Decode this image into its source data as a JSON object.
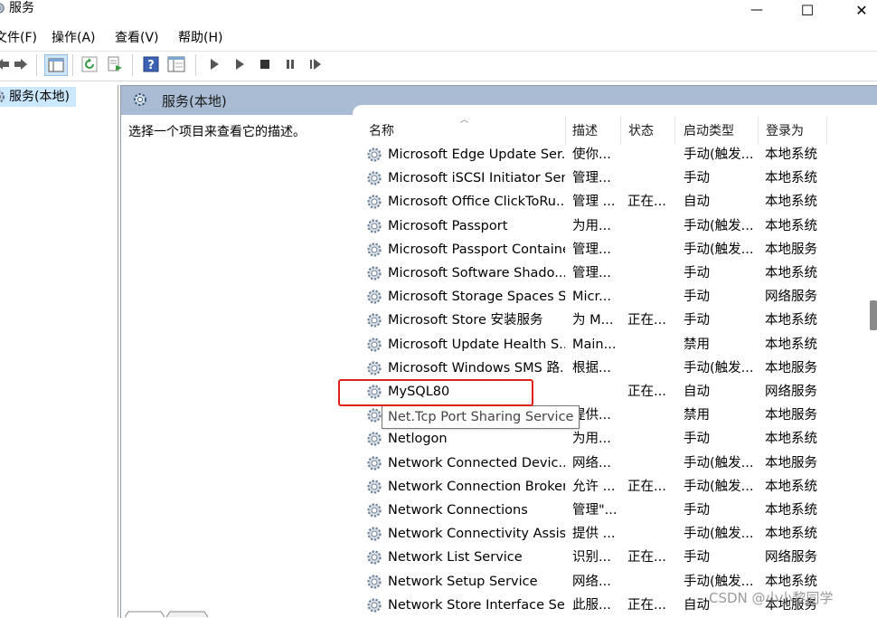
{
  "window": {
    "title": "服务",
    "controls": [
      "—",
      "☐",
      "✕"
    ]
  },
  "menu": {
    "items": [
      "文件(F)",
      "操作(A)",
      "查看(V)",
      "帮助(H)"
    ]
  },
  "tree": {
    "selected_label": "服务(本地)"
  },
  "right": {
    "header_title": "服务(本地)",
    "description": "选择一个项目来查看它的描述。"
  },
  "columns": {
    "name": "名称",
    "description": "描述",
    "status": "状态",
    "startup": "启动类型",
    "logon": "登录为"
  },
  "services": [
    {
      "name": "Microsoft Edge Update Ser...",
      "desc": "使你...",
      "status": "",
      "startup": "手动(触发...",
      "logon": "本地系统"
    },
    {
      "name": "Microsoft iSCSI Initiator Ser...",
      "desc": "管理...",
      "status": "",
      "startup": "手动",
      "logon": "本地系统"
    },
    {
      "name": "Microsoft Office ClickToRu...",
      "desc": "管理 ...",
      "status": "正在...",
      "startup": "自动",
      "logon": "本地系统"
    },
    {
      "name": "Microsoft Passport",
      "desc": "为用...",
      "status": "",
      "startup": "手动(触发...",
      "logon": "本地系统"
    },
    {
      "name": "Microsoft Passport Container",
      "desc": "管理...",
      "status": "",
      "startup": "手动(触发...",
      "logon": "本地服务"
    },
    {
      "name": "Microsoft Software Shado...",
      "desc": "管理...",
      "status": "",
      "startup": "手动",
      "logon": "本地系统"
    },
    {
      "name": "Microsoft Storage Spaces S...",
      "desc": "Micr...",
      "status": "",
      "startup": "手动",
      "logon": "网络服务"
    },
    {
      "name": "Microsoft Store 安装服务",
      "desc": "为 M...",
      "status": "正在...",
      "startup": "手动",
      "logon": "本地系统"
    },
    {
      "name": "Microsoft Update Health S...",
      "desc": "Main...",
      "status": "",
      "startup": "禁用",
      "logon": "本地系统"
    },
    {
      "name": "Microsoft Windows SMS 路...",
      "desc": "根据...",
      "status": "",
      "startup": "手动(触发...",
      "logon": "本地服务"
    },
    {
      "name": "MySQL80",
      "desc": "",
      "status": "正在...",
      "startup": "自动",
      "logon": "网络服务"
    },
    {
      "name": "Net.Tcp Port Sharing Service",
      "desc": "提供...",
      "status": "",
      "startup": "禁用",
      "logon": "本地服务"
    },
    {
      "name": "Netlogon",
      "desc": "为用...",
      "status": "",
      "startup": "手动",
      "logon": "本地系统"
    },
    {
      "name": "Network Connected Devic...",
      "desc": "网络...",
      "status": "",
      "startup": "手动(触发...",
      "logon": "本地服务"
    },
    {
      "name": "Network Connection Broker",
      "desc": "允许 ...",
      "status": "正在...",
      "startup": "手动(触发...",
      "logon": "本地系统"
    },
    {
      "name": "Network Connections",
      "desc": "管理\"...",
      "status": "",
      "startup": "手动",
      "logon": "本地系统"
    },
    {
      "name": "Network Connectivity Assis...",
      "desc": "提供 ...",
      "status": "",
      "startup": "手动(触发...",
      "logon": "本地系统"
    },
    {
      "name": "Network List Service",
      "desc": "识别...",
      "status": "正在...",
      "startup": "手动",
      "logon": "网络服务"
    },
    {
      "name": "Network Setup Service",
      "desc": "网络...",
      "status": "",
      "startup": "手动(触发...",
      "logon": "本地系统"
    },
    {
      "name": "Network Store Interface Se...",
      "desc": "此服...",
      "status": "正在...",
      "startup": "自动",
      "logon": "本地服务"
    }
  ],
  "tooltip": "Net.Tcp Port Sharing Service",
  "watermark": "CSDN @小小黎同学",
  "colors": {
    "header_band": "#a9bcd3",
    "selection": "#cce8ff",
    "highlight_border": "#e0201b"
  }
}
